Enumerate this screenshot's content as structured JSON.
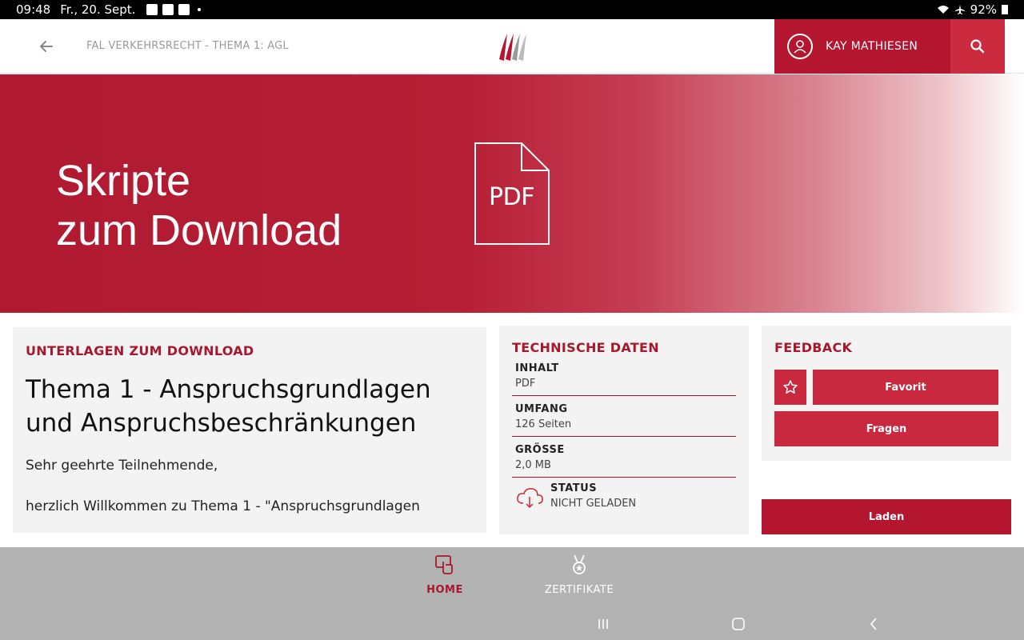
{
  "status_bar": {
    "time": "09:48",
    "date": "Fr., 20. Sept.",
    "battery": "92%"
  },
  "header": {
    "breadcrumb": "FAL VERKEHRSRECHT - THEMA 1: AGL",
    "user_name": "KAY MATHIESEN"
  },
  "banner": {
    "line1": "Skripte",
    "line2": "zum Download",
    "pdf_label": "PDF"
  },
  "main": {
    "section_label": "UNTERLAGEN ZUM DOWNLOAD",
    "title": "Thema 1 - Anspruchsgrundlagen und Anspruchsbeschränkungen",
    "greeting": "Sehr geehrte Teilnehmende,",
    "welcome": "herzlich Willkommen zu Thema 1 - \"Anspruchsgrundlagen"
  },
  "tech": {
    "section_label": "TECHNISCHE DATEN",
    "rows": [
      {
        "label": "INHALT",
        "value": "PDF"
      },
      {
        "label": "UMFANG",
        "value": "126 Seiten"
      },
      {
        "label": "GRÖSSE",
        "value": "2,0 MB"
      }
    ],
    "status_label": "STATUS",
    "status_value": "NICHT GELADEN"
  },
  "feedback": {
    "section_label": "FEEDBACK",
    "favorite": "Favorit",
    "questions": "Fragen"
  },
  "load_button": "Laden",
  "bottom_nav": {
    "home": "HOME",
    "certificates": "ZERTIFIKATE"
  },
  "colors": {
    "brand_red": "#b3162e",
    "button_red": "#c8293f",
    "heading_red": "#a8182d"
  }
}
